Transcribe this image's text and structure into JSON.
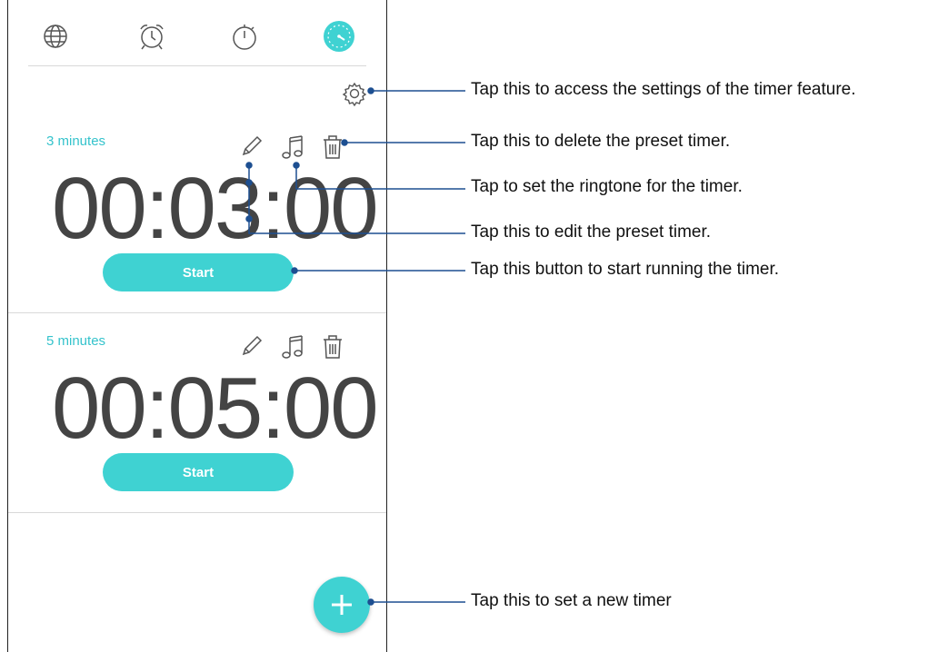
{
  "tabs": [
    {
      "icon": "globe-icon",
      "active": false
    },
    {
      "icon": "alarm-clock-icon",
      "active": false
    },
    {
      "icon": "stopwatch-icon",
      "active": false
    },
    {
      "icon": "timer-icon",
      "active": true
    }
  ],
  "timers": [
    {
      "label": "3 minutes",
      "value": "00:03:00",
      "start_label": "Start"
    },
    {
      "label": "5 minutes",
      "value": "00:05:00",
      "start_label": "Start"
    }
  ],
  "colors": {
    "accent": "#3fd2d2",
    "label": "#35c3cc",
    "callout_line": "#1d4f91"
  },
  "callouts": {
    "settings": "Tap this to access the settings of the timer feature.",
    "delete": "Tap this to delete the preset timer.",
    "ringtone": "Tap to set the ringtone for the timer.",
    "edit": "Tap this to edit the preset timer.",
    "start": "Tap this button to start running the timer.",
    "new_timer": "Tap this to set a new timer"
  }
}
